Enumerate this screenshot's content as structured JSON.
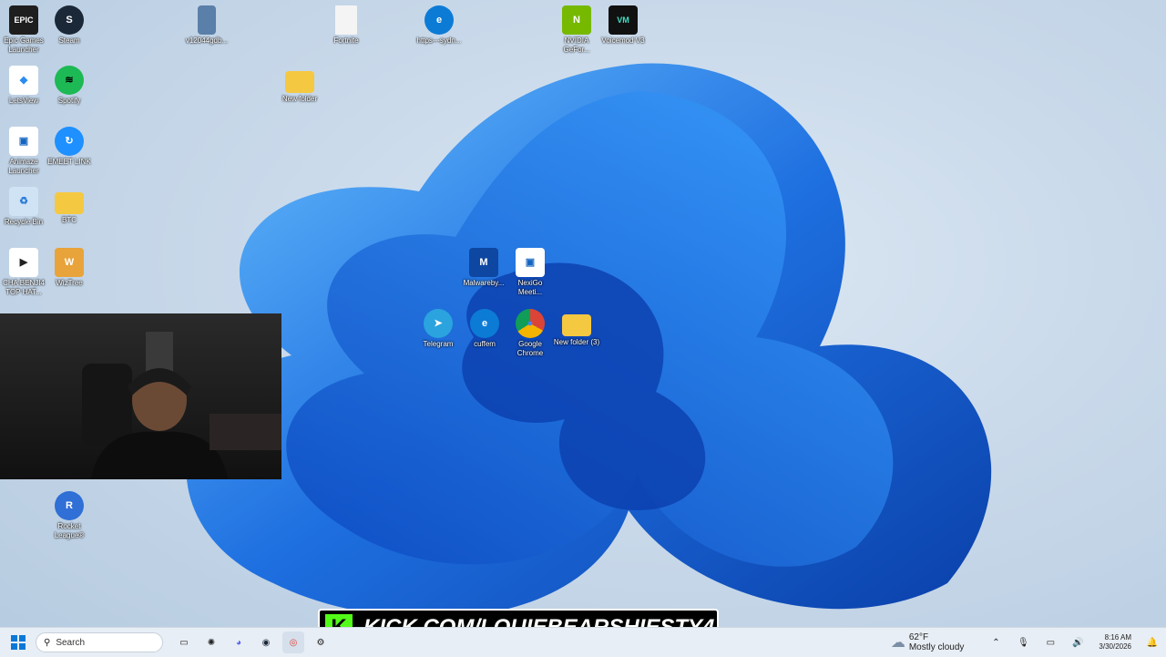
{
  "desktop_icons": [
    {
      "label": "Epic Games Launcher",
      "icon": "epic-games-icon",
      "color": "#1e1e1e",
      "glyph": "EPIC"
    },
    {
      "label": "Steam",
      "icon": "steam-icon",
      "color": "#1b2838",
      "glyph": "S"
    },
    {
      "label": "v12044gdb...",
      "icon": "image-file-icon",
      "color": "#5a7fa8",
      "glyph": ""
    },
    {
      "label": "Fortnite",
      "icon": "document-icon",
      "color": "#f4f4f4",
      "glyph": ""
    },
    {
      "label": "https---sydn...",
      "icon": "edge-icon",
      "color": "#0c7bd6",
      "glyph": "e"
    },
    {
      "label": "NVIDIA GeFor...",
      "icon": "nvidia-icon",
      "color": "#76b900",
      "glyph": "N"
    },
    {
      "label": "Voicemod V3",
      "icon": "voicemod-icon",
      "color": "#111",
      "glyph": "VM"
    },
    {
      "label": "LetsView",
      "icon": "letsview-icon",
      "color": "#ffffff",
      "glyph": "◆"
    },
    {
      "label": "Spotify",
      "icon": "spotify-icon",
      "color": "#1db954",
      "glyph": "≋"
    },
    {
      "label": "New folder",
      "icon": "folder-icon",
      "color": "#f5c842",
      "glyph": ""
    },
    {
      "label": "Animaze Launcher",
      "icon": "animaze-icon",
      "color": "#ffffff",
      "glyph": "▣"
    },
    {
      "label": "EMEET LINK",
      "icon": "emeet-icon",
      "color": "#1e90ff",
      "glyph": "↻"
    },
    {
      "label": "Recycle Bin",
      "icon": "recycle-bin-icon",
      "color": "#cfe3f5",
      "glyph": "♻"
    },
    {
      "label": "BTC",
      "icon": "folder-icon",
      "color": "#f5c842",
      "glyph": ""
    },
    {
      "label": "CHA BENJI4 TOP HAT...",
      "icon": "video-file-icon",
      "color": "#ffffff",
      "glyph": "▶"
    },
    {
      "label": "WizTree",
      "icon": "wiztree-icon",
      "color": "#e8a33a",
      "glyph": "🌲"
    },
    {
      "label": "Malwareby...",
      "icon": "malwarebytes-icon",
      "color": "#0d47a1",
      "glyph": "M"
    },
    {
      "label": "NexiGo Meeti...",
      "icon": "nexigo-icon",
      "color": "#ffffff",
      "glyph": "▣"
    },
    {
      "label": "Telegram",
      "icon": "telegram-icon",
      "color": "#2aa3df",
      "glyph": "➤"
    },
    {
      "label": "cuffem",
      "icon": "edge-icon",
      "color": "#0c7bd6",
      "glyph": "e"
    },
    {
      "label": "Google Chrome",
      "icon": "chrome-icon",
      "color": "#ffffff",
      "glyph": "◉"
    },
    {
      "label": "New folder (3)",
      "icon": "folder-icon",
      "color": "#f5c842",
      "glyph": ""
    },
    {
      "label": "Rocket League®",
      "icon": "rocket-league-icon",
      "color": "#2f6fd6",
      "glyph": "R"
    }
  ],
  "taskbar": {
    "search_placeholder": "Search",
    "apps": [
      "start-icon",
      "task-view-icon",
      "chatgpt-icon",
      "discord-icon",
      "steam-icon",
      "chrome-icon",
      "settings-icon"
    ]
  },
  "stream_overlay": {
    "text": "KICK.COM/LOUIEBEARSHIESTY4",
    "logo": "K"
  },
  "weather": {
    "temp": "62°F",
    "condition": "Mostly cloudy"
  },
  "clock": {
    "time": "8:16 AM",
    "date": "3/30/2026"
  },
  "colors": {
    "kick_green": "#53fc18",
    "wallpaper_blue": "#1e6fe0"
  }
}
